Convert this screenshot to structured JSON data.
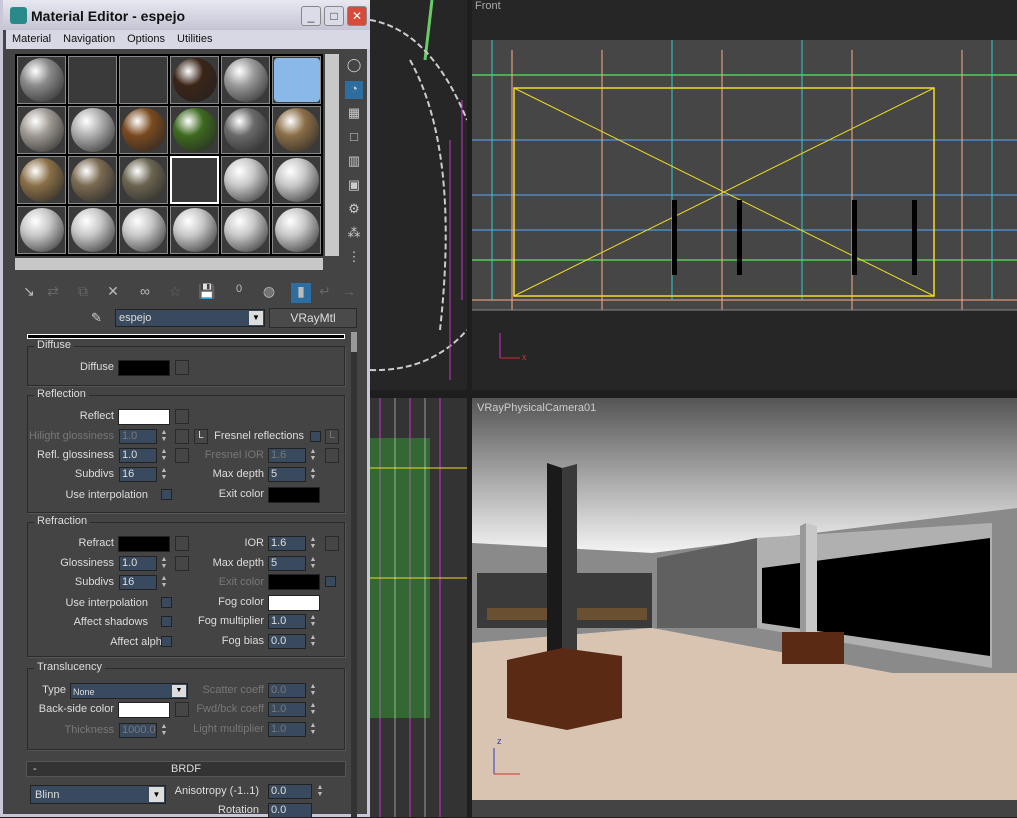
{
  "window": {
    "title": "Material Editor - espejo",
    "minimize": "_",
    "maximize": "□",
    "close": "✕"
  },
  "menu": [
    "Material",
    "Navigation",
    "Options",
    "Utilities"
  ],
  "slots": [
    "#8a8a8a",
    "#3a3a3a",
    "#3a3a3a",
    "#3b2418",
    "#9a9a9a",
    "#8ab8e8",
    "#a09a94",
    "#b0b0b0",
    "#7a4a20",
    "#3e6a20",
    "#6a6a6a",
    "#8a6e48",
    "#8a7048",
    "#7a6a52",
    "#6a6450",
    "#2e2e2e",
    "#c8c8c8",
    "#c8c8c8",
    "#c8c8c8",
    "#c8c8c8",
    "#c8c8c8",
    "#c8c8c8",
    "#c8c8c8",
    "#c8c8c8"
  ],
  "name_row": {
    "material_name": "espejo",
    "material_type": "VRayMtl"
  },
  "toolbar": {
    "mtl_id": "0"
  },
  "diffuse": {
    "title": "Diffuse",
    "label": "Diffuse",
    "color": "#000000"
  },
  "reflection": {
    "title": "Reflection",
    "reflect": "Reflect",
    "reflect_color": "#ffffff",
    "hilight": "Hilight glossiness",
    "hilight_val": "1.0",
    "lock": "L",
    "fresnel": "Fresnel reflections",
    "fresnel_lock": "L",
    "refl_gloss": "Refl. glossiness",
    "refl_gloss_val": "1.0",
    "fresnel_ior": "Fresnel IOR",
    "fresnel_ior_val": "1.6",
    "subdivs": "Subdivs",
    "subdivs_val": "16",
    "max_depth": "Max depth",
    "max_depth_val": "5",
    "use_interp": "Use interpolation",
    "exit_color": "Exit color"
  },
  "refraction": {
    "title": "Refraction",
    "refract": "Refract",
    "ior": "IOR",
    "ior_val": "1.6",
    "gloss": "Glossiness",
    "gloss_val": "1.0",
    "max_depth": "Max depth",
    "max_depth_val": "5",
    "subdivs": "Subdivs",
    "subdivs_val": "16",
    "exit_color": "Exit color",
    "use_interp": "Use interpolation",
    "fog_color": "Fog color",
    "affect_shadows": "Affect shadows",
    "fog_mult": "Fog multiplier",
    "fog_mult_val": "1.0",
    "affect_alpha": "Affect alpha",
    "fog_bias": "Fog bias",
    "fog_bias_val": "0.0"
  },
  "translucency": {
    "title": "Translucency",
    "type": "Type",
    "type_val": "None",
    "scatter": "Scatter coeff",
    "scatter_val": "0.0",
    "back": "Back-side color",
    "fwd": "Fwd/bck coeff",
    "fwd_val": "1.0",
    "thickness": "Thickness",
    "thickness_val": "1000.0",
    "light_mult": "Light multiplier",
    "light_mult_val": "1.0"
  },
  "brdf": {
    "collapse": "-",
    "title": "BRDF",
    "type_val": "Blinn",
    "aniso": "Anisotropy (-1..1)",
    "aniso_val": "0.0",
    "rotation": "Rotation",
    "rotation_val": "0.0"
  },
  "viewports": {
    "front": "Front",
    "camera": "VRayPhysicalCamera01",
    "axis_x": "x",
    "axis_z": "z"
  }
}
